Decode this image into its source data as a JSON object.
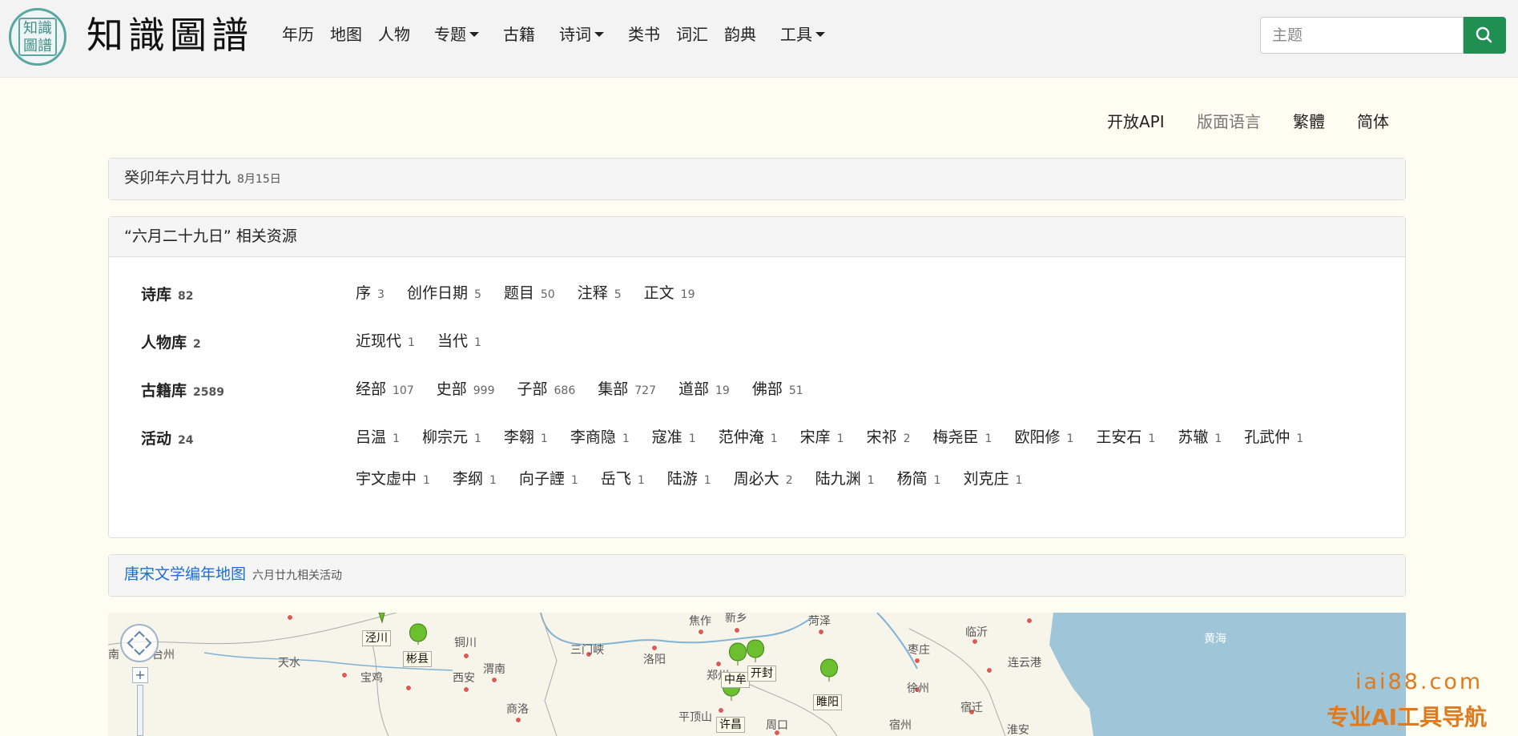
{
  "brand": {
    "title": "知識圖譜",
    "seal_text": "知識圖譜"
  },
  "nav": {
    "items": [
      {
        "label": "年历"
      },
      {
        "label": "地图"
      },
      {
        "label": "人物"
      },
      {
        "label": "专题",
        "dropdown": true
      },
      {
        "label": "古籍"
      },
      {
        "label": "诗词",
        "dropdown": true
      },
      {
        "label": "类书"
      },
      {
        "label": "词汇"
      },
      {
        "label": "韵典"
      },
      {
        "label": "工具",
        "dropdown": true
      }
    ]
  },
  "search": {
    "placeholder": "主题",
    "value": ""
  },
  "util_links": {
    "api": "开放API",
    "lang": "版面语言",
    "traditional": "繁體",
    "simplified": "简体"
  },
  "date_panel": {
    "lunar": "癸卯年六月廿九",
    "solar": "8月15日"
  },
  "resources": {
    "title": "“六月二十九日” 相关资源",
    "rows": [
      {
        "category": "诗库",
        "count": "82",
        "tags": [
          {
            "label": "序",
            "count": "3"
          },
          {
            "label": "创作日期",
            "count": "5"
          },
          {
            "label": "题目",
            "count": "50"
          },
          {
            "label": "注释",
            "count": "5"
          },
          {
            "label": "正文",
            "count": "19"
          }
        ]
      },
      {
        "category": "人物库",
        "count": "2",
        "tags": [
          {
            "label": "近现代",
            "count": "1"
          },
          {
            "label": "当代",
            "count": "1"
          }
        ]
      },
      {
        "category": "古籍库",
        "count": "2589",
        "tags": [
          {
            "label": "经部",
            "count": "107"
          },
          {
            "label": "史部",
            "count": "999"
          },
          {
            "label": "子部",
            "count": "686"
          },
          {
            "label": "集部",
            "count": "727"
          },
          {
            "label": "道部",
            "count": "19"
          },
          {
            "label": "佛部",
            "count": "51"
          }
        ]
      },
      {
        "category": "活动",
        "count": "24",
        "tags": [
          {
            "label": "吕温",
            "count": "1"
          },
          {
            "label": "柳宗元",
            "count": "1"
          },
          {
            "label": "李翱",
            "count": "1"
          },
          {
            "label": "李商隐",
            "count": "1"
          },
          {
            "label": "寇准",
            "count": "1"
          },
          {
            "label": "范仲淹",
            "count": "1"
          },
          {
            "label": "宋庠",
            "count": "1"
          },
          {
            "label": "宋祁",
            "count": "2"
          },
          {
            "label": "梅尧臣",
            "count": "1"
          },
          {
            "label": "欧阳修",
            "count": "1"
          },
          {
            "label": "王安石",
            "count": "1"
          },
          {
            "label": "苏辙",
            "count": "1"
          },
          {
            "label": "孔武仲",
            "count": "1"
          },
          {
            "label": "宇文虚中",
            "count": "1"
          },
          {
            "label": "李纲",
            "count": "1"
          },
          {
            "label": "向子諲",
            "count": "1"
          },
          {
            "label": "岳飞",
            "count": "1"
          },
          {
            "label": "陆游",
            "count": "1"
          },
          {
            "label": "周必大",
            "count": "2"
          },
          {
            "label": "陆九渊",
            "count": "1"
          },
          {
            "label": "杨简",
            "count": "1"
          },
          {
            "label": "刘克庄",
            "count": "1"
          }
        ]
      }
    ]
  },
  "map_panel": {
    "link": "唐宋文学编年地图",
    "sub": "六月廿九相关活动"
  },
  "map": {
    "labels": [
      "天水",
      "宝鸡",
      "铜川",
      "西安",
      "渭南",
      "商洛",
      "三门峡",
      "洛阳",
      "焦作",
      "新乡",
      "郑州",
      "平顶山",
      "周口",
      "菏泽",
      "枣庄",
      "临沂",
      "徐州",
      "连云港",
      "宿迁",
      "宿州",
      "淮安",
      "南",
      "台州",
      "黄海"
    ],
    "markers": [
      "泾川",
      "彬县",
      "中牟",
      "开封",
      "许昌",
      "睢阳"
    ]
  },
  "watermark": {
    "line1": "iai88.com",
    "line2": "专业AI工具导航"
  },
  "colors": {
    "accent_green": "#1f9052",
    "link_blue": "#1a6ed8",
    "sea": "#9ec5d8",
    "watermark": "#e07a1f"
  }
}
